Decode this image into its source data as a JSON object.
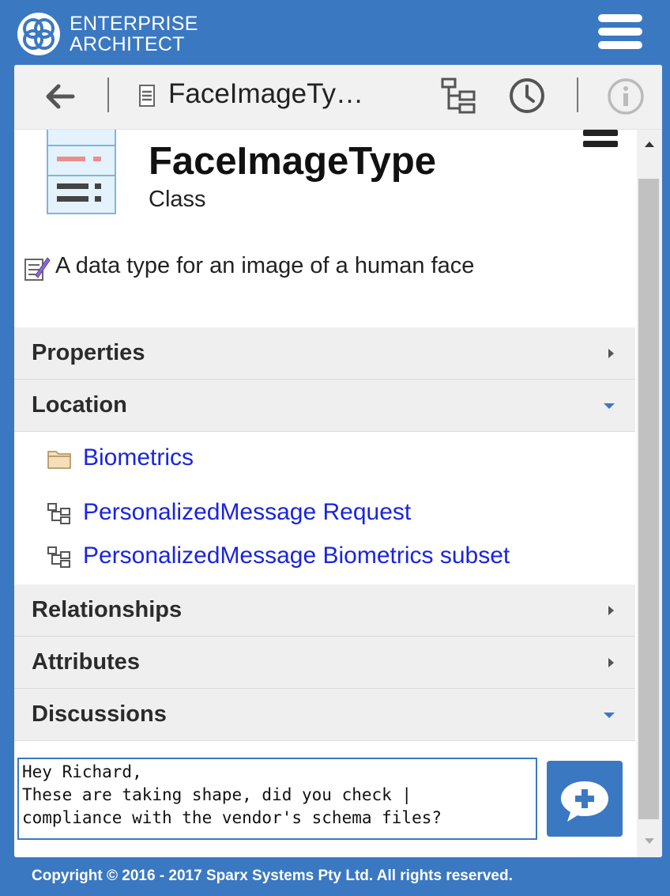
{
  "brand": {
    "line1": "ENTERPRISE",
    "line2": "ARCHITECT"
  },
  "toolbar": {
    "title": "FaceImageTy…"
  },
  "element": {
    "name": "FaceImageType",
    "type": "Class",
    "notes": "A data type for an image of a human face"
  },
  "sections": {
    "properties": "Properties",
    "location": "Location",
    "relationships": "Relationships",
    "attributes": "Attributes",
    "discussions": "Discussions"
  },
  "location_items": [
    {
      "label": "Biometrics",
      "icon": "folder-icon"
    },
    {
      "label": "PersonalizedMessage Request",
      "icon": "diagram-icon"
    },
    {
      "label": "PersonalizedMessage Biometrics subset",
      "icon": "diagram-icon"
    }
  ],
  "discussion": {
    "draft": "Hey Richard,\nThese are taking shape, did you check |\ncompliance with the vendor's schema files?"
  },
  "footer": {
    "copyright": "Copyright © 2016 - 2017 Sparx Systems Pty Ltd. All rights reserved."
  },
  "colors": {
    "accent": "#3b78c2",
    "link": "#1a24e0",
    "section_bg": "#efefef"
  }
}
